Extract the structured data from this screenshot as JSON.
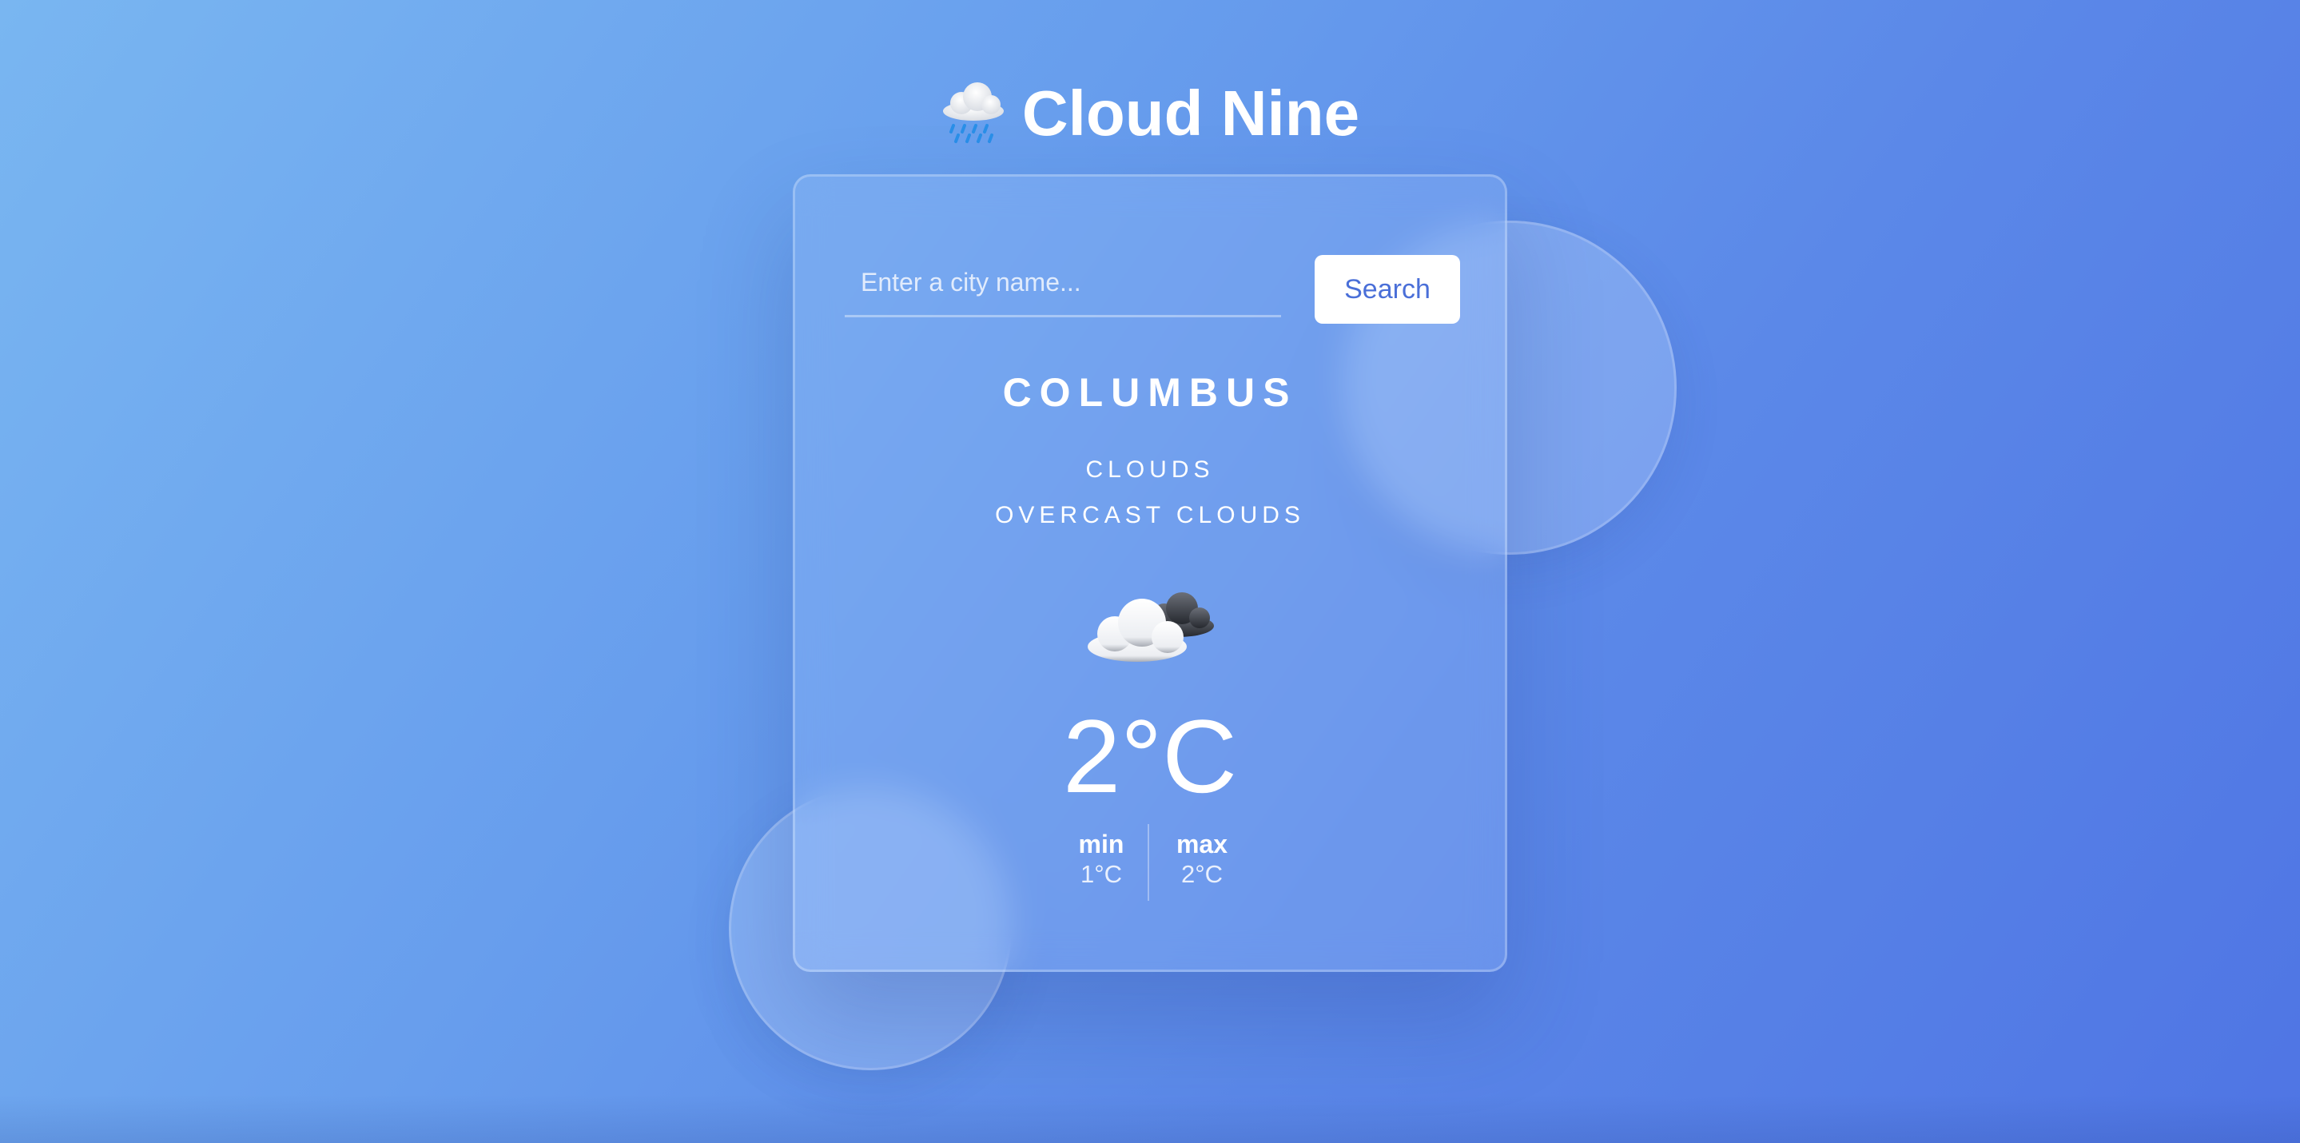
{
  "app": {
    "title": "Cloud Nine",
    "title_icon": "cloud-rain-icon"
  },
  "search": {
    "placeholder": "Enter a city name...",
    "value": "",
    "button_label": "Search"
  },
  "weather": {
    "city": "COLUMBUS",
    "condition": "CLOUDS",
    "description": "OVERCAST CLOUDS",
    "icon": "overcast-clouds-icon",
    "temperature": "2°C",
    "min_label": "min",
    "min_value": "1°C",
    "max_label": "max",
    "max_value": "2°C"
  },
  "colors": {
    "background_start": "#79b6f1",
    "background_end": "#4f75e4",
    "button_text": "#4a6fd8",
    "text": "#ffffff"
  }
}
